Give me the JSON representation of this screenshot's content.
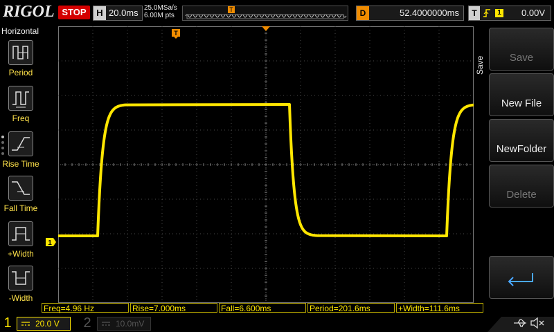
{
  "topbar": {
    "logo": "RIGOL",
    "run_state": "STOP",
    "horizontal_label": "H",
    "timebase": "20.0ms",
    "sample_rate": "25.0MSa/s",
    "memory_depth": "6.00M pts",
    "trigger_marker": "T",
    "delay_label": "D",
    "delay_value": "52.4000000ms",
    "trigger_label": "T",
    "trigger_source": "1",
    "trigger_level": "0.00V"
  },
  "left_menu": {
    "title": "Horizontal",
    "items": [
      {
        "label": "Period",
        "icon": "period-icon"
      },
      {
        "label": "Freq",
        "icon": "frequency-icon"
      },
      {
        "label": "Rise Time",
        "icon": "rise-time-icon"
      },
      {
        "label": "Fall Time",
        "icon": "fall-time-icon"
      },
      {
        "label": "+Width",
        "icon": "positive-width-icon"
      },
      {
        "label": "-Width",
        "icon": "negative-width-icon"
      }
    ]
  },
  "screen": {
    "ch1_marker": "1",
    "trigger_top_marker": "T",
    "trigger_level_marker": "T",
    "trace_color": "#ffe600",
    "grid_color": "#4a4a4a"
  },
  "right_menu": {
    "title": "Save",
    "buttons": [
      {
        "label": "Save",
        "enabled": false
      },
      {
        "label": "New File",
        "enabled": true
      },
      {
        "label": "NewFolder",
        "enabled": true
      },
      {
        "label": "Delete",
        "enabled": false
      },
      {
        "label": "",
        "enabled": true,
        "icon": "return-arrow-icon"
      }
    ]
  },
  "measurements": [
    "Freq=4.96 Hz",
    "Rise=7.000ms",
    "Fall=6.600ms",
    "Period=201.6ms",
    "+Width=111.6ms"
  ],
  "bottombar": {
    "ch1_number": "1",
    "ch1_scale": "20.0 V",
    "ch2_number": "2",
    "ch2_scale": "10.0mV",
    "icons": [
      "usb-icon",
      "mute-icon"
    ]
  },
  "colors": {
    "ch1": "#ffe600",
    "stop": "#d40000",
    "delay": "#f08c00"
  }
}
